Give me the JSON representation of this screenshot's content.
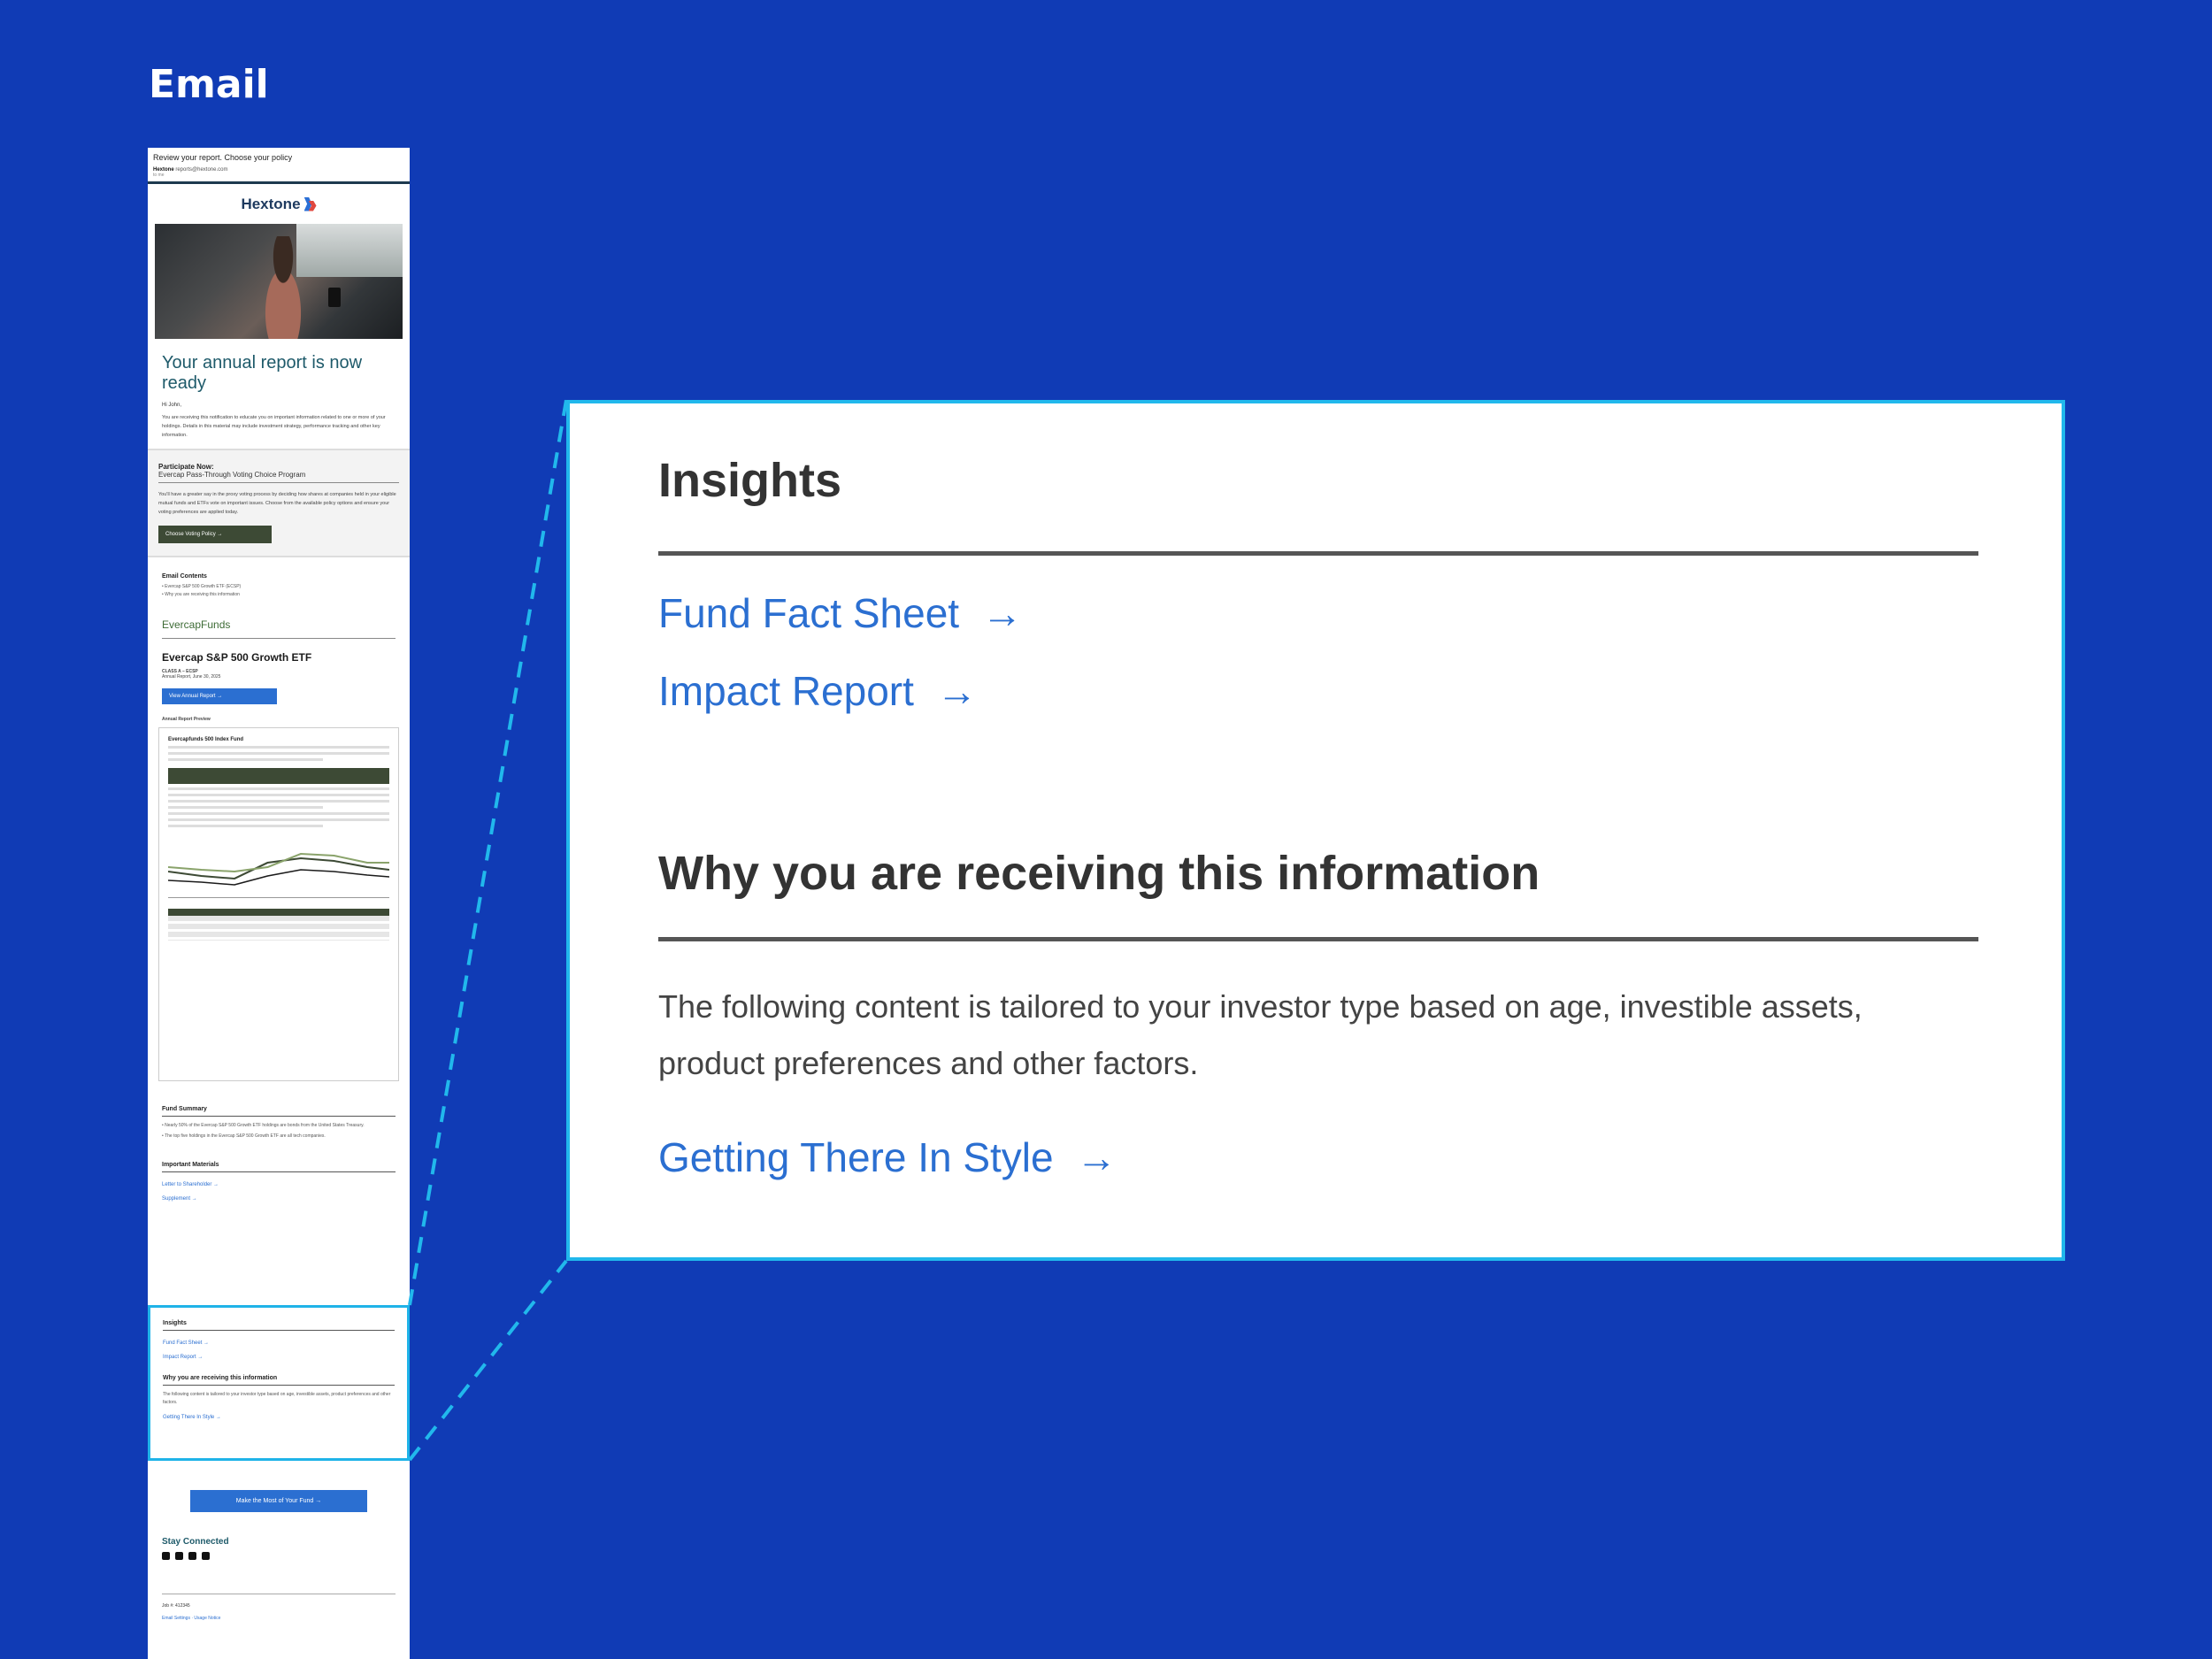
{
  "section_label": "Email",
  "email": {
    "subject": "Review your report. Choose your policy",
    "from_name": "Hextone",
    "from_addr": "reports@hextone.com",
    "to": "to me",
    "brand": "Hextone",
    "title": "Your annual report is now ready",
    "greeting": "Hi John,",
    "intro": "You are receiving this notification to educate you on important information related to one or more of your holdings. Details in this material may include investment strategy, performance tracking and other key information.",
    "participate": {
      "heading": "Participate Now:",
      "program": "Evercap Pass-Through Voting Choice Program",
      "text": "You'll have a greater say in the proxy voting process by deciding how shares at companies held in your eligible mutual funds and ETFs vote on important issues. Choose from the available policy options and ensure your voting preferences are applied today.",
      "button": "Choose Voting Policy →"
    },
    "contents": {
      "heading": "Email Contents",
      "items": [
        "Evercap S&P 500 Growth ETF (ECSP)",
        "Why you are receiving this information"
      ]
    },
    "fund_brand": "EvercapFunds",
    "fund_name": "Evercap S&P 500 Growth ETF",
    "fund_class": "CLASS A – ECSP",
    "fund_date": "Annual Report, June 30, 2025",
    "view_button": "View Annual Report →",
    "preview_label": "Annual Report Preview",
    "preview_title": "Evercapfunds 500 Index Fund",
    "fund_summary": {
      "heading": "Fund Summary",
      "items": [
        "Nearly 50% of the Evercap S&P 500 Growth ETF holdings are bonds from the United States Treasury.",
        "The top five holdings in the Evercap S&P 500 Growth ETF are all tech companies."
      ]
    },
    "materials": {
      "heading": "Important Materials",
      "links": [
        "Letter to Shareholder →",
        "Supplement →"
      ]
    },
    "insights": {
      "heading": "Insights",
      "links": [
        "Fund Fact Sheet →",
        "Impact Report →"
      ],
      "why_heading": "Why you are receiving this information",
      "why_text": "The following content is tailored to your investor type based on age, investible assets, product preferences and other factors.",
      "why_link": "Getting There In Style →"
    },
    "cta": "Make the Most of Your Fund →",
    "stay_connected": "Stay Connected",
    "job": "Job #: 412345",
    "footer_links": "Email Settings · Usage Notice"
  },
  "zoom": {
    "heading": "Insights",
    "link1": "Fund Fact Sheet",
    "link2": "Impact Report",
    "why_heading": "Why you are receiving this information",
    "why_text": "The following content is tailored to your investor type based on age, investible assets, product preferences and other factors.",
    "why_link": "Getting There In Style",
    "arrow": "→"
  },
  "colors": {
    "background": "#103bb5",
    "highlight": "#21b8ec",
    "link": "#2b6fd1"
  }
}
